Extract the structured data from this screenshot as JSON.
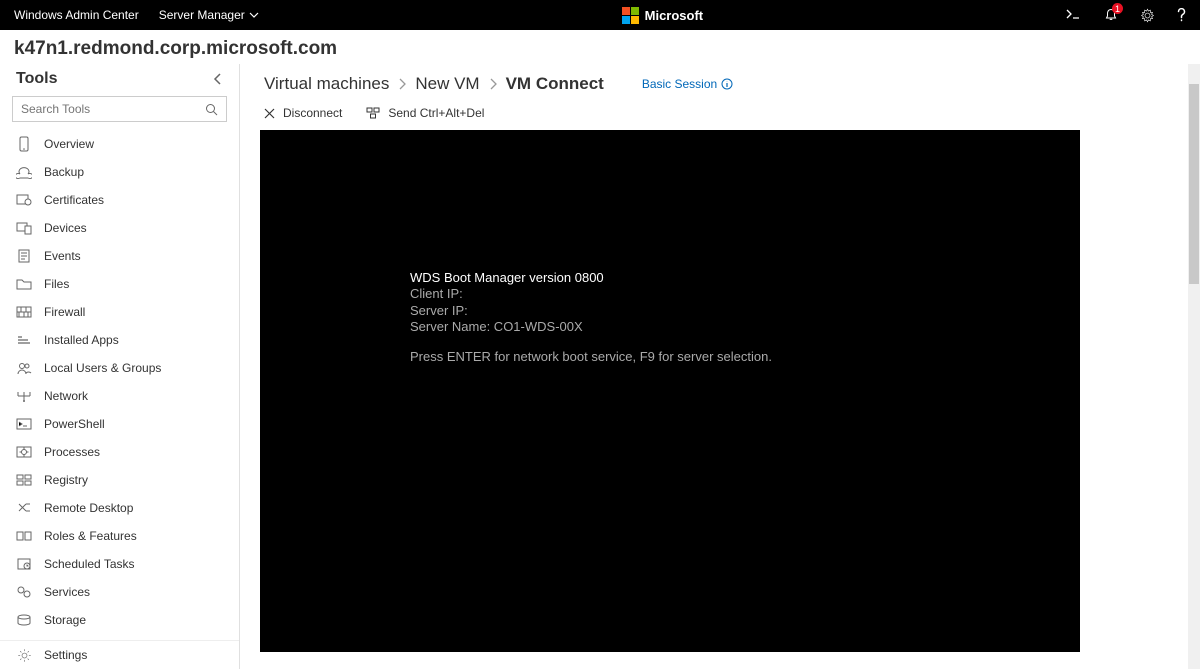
{
  "topbar": {
    "app_title": "Windows Admin Center",
    "menu_label": "Server Manager",
    "brand": "Microsoft",
    "notification_count": "1"
  },
  "server_name": "k47n1.redmond.corp.microsoft.com",
  "sidebar": {
    "header": "Tools",
    "search_placeholder": "Search Tools",
    "items": [
      {
        "label": "Overview"
      },
      {
        "label": "Backup"
      },
      {
        "label": "Certificates"
      },
      {
        "label": "Devices"
      },
      {
        "label": "Events"
      },
      {
        "label": "Files"
      },
      {
        "label": "Firewall"
      },
      {
        "label": "Installed Apps"
      },
      {
        "label": "Local Users & Groups"
      },
      {
        "label": "Network"
      },
      {
        "label": "PowerShell"
      },
      {
        "label": "Processes"
      },
      {
        "label": "Registry"
      },
      {
        "label": "Remote Desktop"
      },
      {
        "label": "Roles & Features"
      },
      {
        "label": "Scheduled Tasks"
      },
      {
        "label": "Services"
      },
      {
        "label": "Storage"
      }
    ],
    "settings_label": "Settings"
  },
  "breadcrumb": {
    "0": "Virtual machines",
    "1": "New VM",
    "2": "VM Connect",
    "session_label": "Basic Session"
  },
  "actions": {
    "disconnect": "Disconnect",
    "ctrlaltdel": "Send Ctrl+Alt+Del"
  },
  "console": {
    "line1": "WDS Boot Manager version 0800",
    "line2a": "Client IP:",
    "line2b": "   ",
    "line3a": "Server IP:",
    "line3b": "   ",
    "line4": "Server Name: CO1-WDS-00X",
    "line5": "Press ENTER for network boot service, F9 for server selection."
  }
}
